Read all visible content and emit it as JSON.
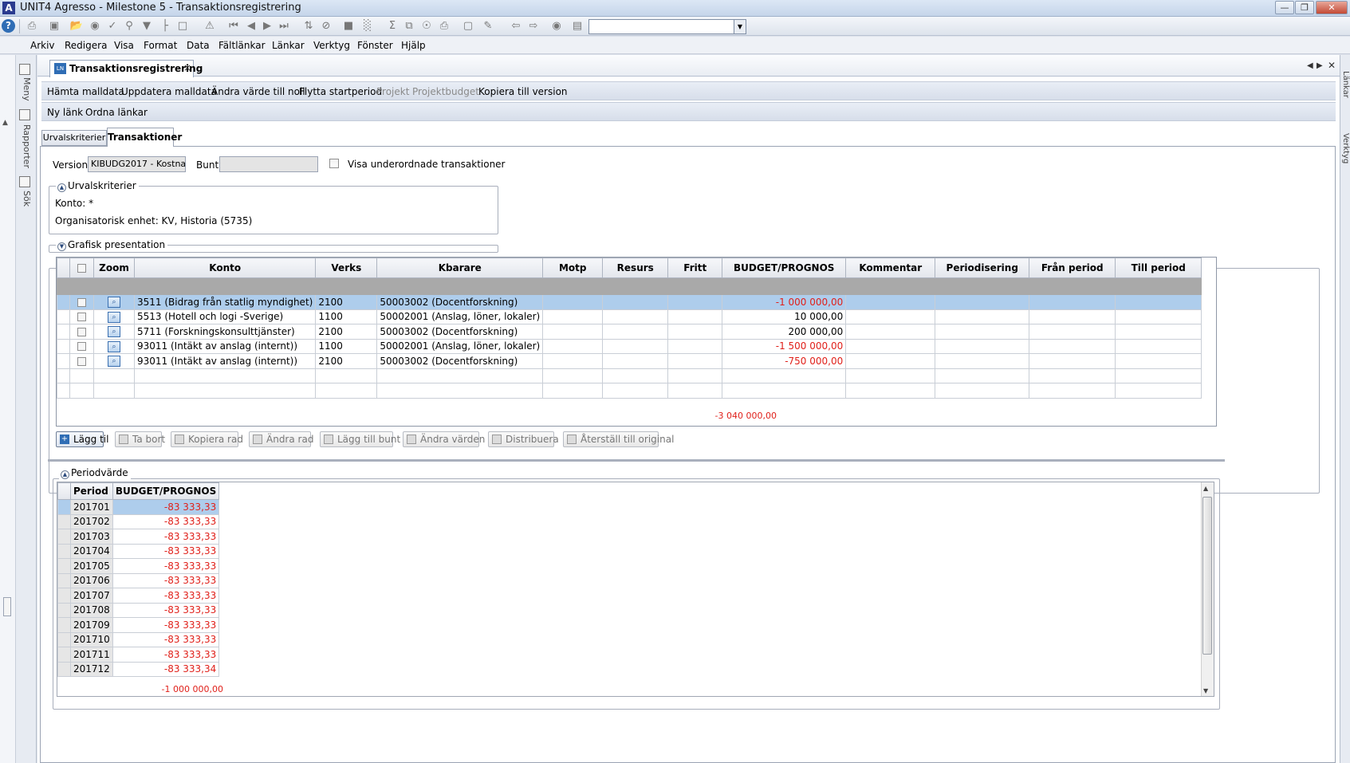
{
  "window": {
    "app_logo": "A",
    "title": "UNIT4 Agresso - Milestone 5 - Transaktionsregistrering",
    "controls": [
      "minimize-icon",
      "restore-icon",
      "close-icon"
    ]
  },
  "toolbar": {
    "icons": [
      "help-icon",
      "print-icon",
      "save-icon",
      "open-icon",
      "binoculars-icon",
      "check-icon",
      "search-icon",
      "filter-icon",
      "tree-icon",
      "clear-icon",
      "note-icon",
      "first-icon",
      "prev-icon",
      "next-icon",
      "last-icon",
      "split-icon",
      "stop-icon",
      "chart-icon",
      "sum-icon",
      "copy-icon",
      "zoom-icon",
      "printer2-icon",
      "screen-icon",
      "crayons-icon",
      "back-icon",
      "forward-icon",
      "record-icon",
      "view-icon"
    ],
    "combo_value": ""
  },
  "menu": [
    "Arkiv",
    "Redigera",
    "Visa",
    "Format",
    "Data",
    "Fältlänkar",
    "Länkar",
    "Verktyg",
    "Fönster",
    "Hjälp"
  ],
  "left_panel": {
    "tabs": [
      "Meny",
      "Rapporter",
      "Sök"
    ]
  },
  "right_panel": {
    "tabs": [
      "Länkar",
      "Verktyg"
    ]
  },
  "document_tab": {
    "icon": "LN",
    "label": "Transaktionsregistrering",
    "close": "×"
  },
  "actions_row1": [
    {
      "label": "Hämta malldata",
      "enabled": true
    },
    {
      "label": "Uppdatera malldata",
      "enabled": true
    },
    {
      "label": "Ändra värde till noll",
      "enabled": true
    },
    {
      "label": "Flytta startperiod",
      "enabled": true
    },
    {
      "label": "Projekt",
      "enabled": false
    },
    {
      "label": "Projektbudget",
      "enabled": false
    },
    {
      "label": "Kopiera till version",
      "enabled": true
    }
  ],
  "actions_row2": [
    {
      "label": "Ny länk",
      "enabled": true
    },
    {
      "label": "Ordna länkar",
      "enabled": true
    }
  ],
  "tabs": {
    "urval": "Urvalskriterier",
    "trans": "Transaktioner"
  },
  "filter": {
    "version_label": "Version",
    "version_value": "KIBUDG2017 - Kostna",
    "bunt_label": "Bunt",
    "bunt_value": "",
    "show_sub_label": "Visa underordnade transaktioner"
  },
  "urval_group": {
    "title": "Urvalskriterier",
    "konto": "Konto: *",
    "org": "Organisatorisk enhet: KV, Historia (5735)"
  },
  "graf_group": {
    "title": "Grafisk presentation"
  },
  "grid": {
    "headers": [
      "Zoom",
      "Konto",
      "Verks",
      "Kbarare",
      "Motp",
      "Resurs",
      "Fritt",
      "BUDGET/PROGNOS",
      "Kommentar",
      "Periodisering",
      "Från period",
      "Till period"
    ],
    "rows": [
      {
        "konto": "3511 (Bidrag från statlig myndighet)",
        "verks": "2100",
        "kbarare": "50003002 (Docentforskning)",
        "budget": "-1 000 000,00",
        "negative": true,
        "selected": true
      },
      {
        "konto": "5513 (Hotell och logi -Sverige)",
        "verks": "1100",
        "kbarare": "50002001 (Anslag, löner, lokaler)",
        "budget": "10 000,00",
        "negative": false,
        "selected": false
      },
      {
        "konto": "5711 (Forskningskonsulttjänster)",
        "verks": "2100",
        "kbarare": "50003002 (Docentforskning)",
        "budget": "200 000,00",
        "negative": false,
        "selected": false
      },
      {
        "konto": "93011 (Intäkt av anslag (internt))",
        "verks": "1100",
        "kbarare": "50002001 (Anslag, löner, lokaler)",
        "budget": "-1 500 000,00",
        "negative": true,
        "selected": false
      },
      {
        "konto": "93011 (Intäkt av anslag (internt))",
        "verks": "2100",
        "kbarare": "50003002 (Docentforskning)",
        "budget": "-750 000,00",
        "negative": true,
        "selected": false
      }
    ],
    "empty_rows": 2,
    "total": "-3 040 000,00"
  },
  "buttons": [
    {
      "label": "Lägg til",
      "enabled": true,
      "icon": "add-icon"
    },
    {
      "label": "Ta bort",
      "enabled": false,
      "icon": "delete-icon"
    },
    {
      "label": "Kopiera rad",
      "enabled": false,
      "icon": "copy-row-icon"
    },
    {
      "label": "Ändra rad",
      "enabled": false,
      "icon": "edit-row-icon"
    },
    {
      "label": "Lägg till bunt",
      "enabled": false,
      "icon": "add-batch-icon"
    },
    {
      "label": "Ändra värden",
      "enabled": false,
      "icon": "change-values-icon"
    },
    {
      "label": "Distribuera",
      "enabled": false,
      "icon": "distribute-icon"
    },
    {
      "label": "Återställ till original",
      "enabled": false,
      "icon": "restore-original-icon"
    }
  ],
  "period": {
    "title": "Periodvärde",
    "headers": [
      "Period",
      "BUDGET/PROGNOS"
    ],
    "rows": [
      {
        "period": "201701",
        "value": "-83 333,33"
      },
      {
        "period": "201702",
        "value": "-83 333,33"
      },
      {
        "period": "201703",
        "value": "-83 333,33"
      },
      {
        "period": "201704",
        "value": "-83 333,33"
      },
      {
        "period": "201705",
        "value": "-83 333,33"
      },
      {
        "period": "201706",
        "value": "-83 333,33"
      },
      {
        "period": "201707",
        "value": "-83 333,33"
      },
      {
        "period": "201708",
        "value": "-83 333,33"
      },
      {
        "period": "201709",
        "value": "-83 333,33"
      },
      {
        "period": "201710",
        "value": "-83 333,33"
      },
      {
        "period": "201711",
        "value": "-83 333,33"
      },
      {
        "period": "201712",
        "value": "-83 333,34"
      }
    ],
    "total": "-1 000 000,00"
  },
  "colors": {
    "negative": "#e0201a",
    "selection": "#aecdec",
    "accent": "#2f6db5"
  }
}
